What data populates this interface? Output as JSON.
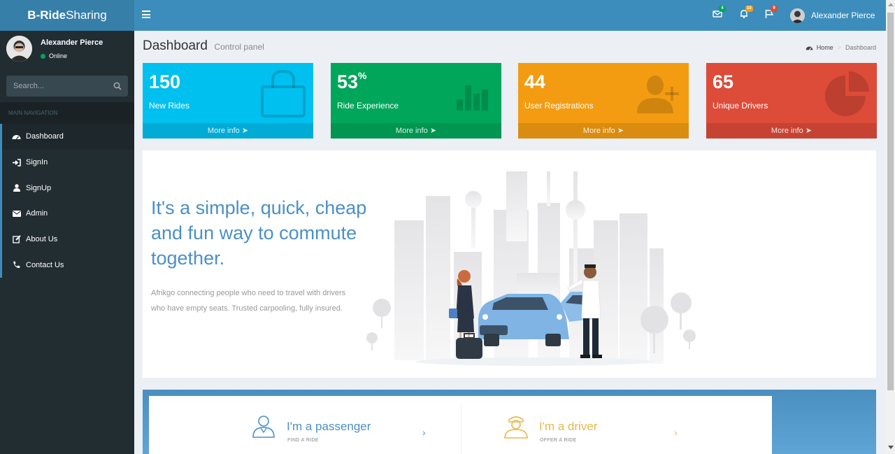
{
  "app": {
    "brand_bold": "B-Ride",
    "brand_rest": " Sharing"
  },
  "header": {
    "mail_count": "4",
    "notification_count": "10",
    "flag_count": "9",
    "user_name": "Alexander Pierce",
    "colors": {
      "bar": "#3c8dbc",
      "logo_bg": "#367fa9",
      "mail_badge": "#00a65a",
      "notif_badge": "#f39c12",
      "flag_badge": "#dd4b39"
    }
  },
  "sidebar": {
    "user_name": "Alexander Pierce",
    "status": "Online",
    "search_placeholder": "Search...",
    "section_header": "MAIN NAVIGATION",
    "items": [
      {
        "label": "Dashboard",
        "icon": "dashboard-icon"
      },
      {
        "label": "SignIn",
        "icon": "sign-in-icon"
      },
      {
        "label": "SignUp",
        "icon": "user-icon"
      },
      {
        "label": "Admin",
        "icon": "envelope-icon"
      },
      {
        "label": "About Us",
        "icon": "edit-icon"
      },
      {
        "label": "Contact Us",
        "icon": "phone-icon"
      }
    ]
  },
  "content_header": {
    "title": "Dashboard",
    "subtitle": "Control panel",
    "breadcrumb": [
      "Home",
      "Dashboard"
    ]
  },
  "stat_boxes": [
    {
      "value": "150",
      "suffix": "",
      "label": "New Rides",
      "footer": "More info",
      "color": "#00c0ef",
      "icon": "shopping-bag-icon"
    },
    {
      "value": "53",
      "suffix": "%",
      "label": "Ride Experience",
      "footer": "More info",
      "color": "#00a65a",
      "icon": "bar-chart-icon"
    },
    {
      "value": "44",
      "suffix": "",
      "label": "User Registrations",
      "footer": "More info",
      "color": "#f39c12",
      "icon": "user-plus-icon"
    },
    {
      "value": "65",
      "suffix": "",
      "label": "Unique Drivers",
      "footer": "More info",
      "color": "#dd4b39",
      "icon": "pie-chart-icon"
    }
  ],
  "hero": {
    "headline": "It's a simple, quick, cheap and fun way to commute together.",
    "description": "Afrikgo connecting people who need to travel with drivers who have empty seats. Trusted carpooling, fully insured."
  },
  "cta": {
    "passenger": {
      "title": "I'm a passenger",
      "subtitle": "FIND A RIDE",
      "color": "#4a90c8"
    },
    "driver": {
      "title": "I'm a driver",
      "subtitle": "OFFER A RIDE",
      "color": "#e8b84a"
    }
  }
}
